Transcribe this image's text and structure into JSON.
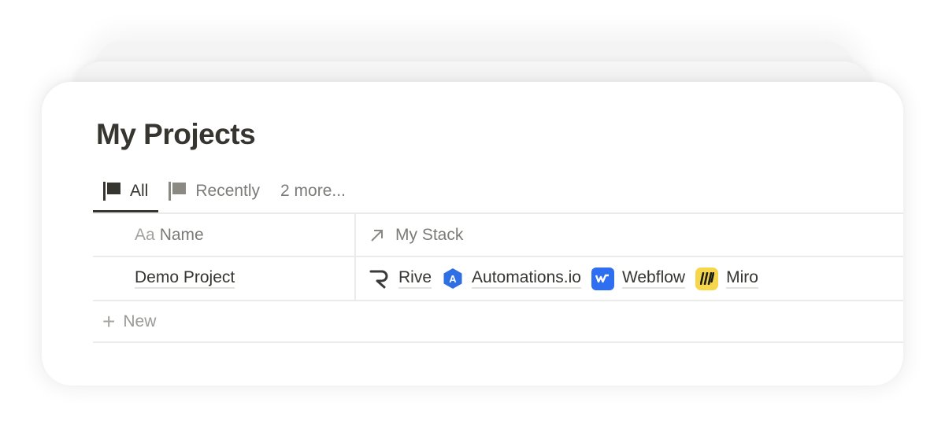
{
  "page": {
    "title": "My Projects"
  },
  "tabs": [
    {
      "label": "All",
      "icon": "flag-icon",
      "active": true
    },
    {
      "label": "Recently",
      "icon": "flag-icon",
      "active": false
    }
  ],
  "more_tabs_label": "2 more...",
  "table": {
    "columns": [
      {
        "label": "Name",
        "icon_text": "Aa",
        "icon": "title-property-icon"
      },
      {
        "label": "My Stack",
        "icon": "relation-arrow-icon"
      }
    ],
    "rows": [
      {
        "name": "Demo Project",
        "stack": [
          {
            "label": "Rive",
            "icon": "rive-logo-icon"
          },
          {
            "label": "Automations.io",
            "icon": "automations-logo-icon",
            "color": "#2f6fe4"
          },
          {
            "label": "Webflow",
            "icon": "webflow-logo-icon",
            "color": "#2d6ff0"
          },
          {
            "label": "Miro",
            "icon": "miro-logo-icon",
            "color": "#f6d64a"
          }
        ]
      }
    ],
    "new_label": "New"
  }
}
